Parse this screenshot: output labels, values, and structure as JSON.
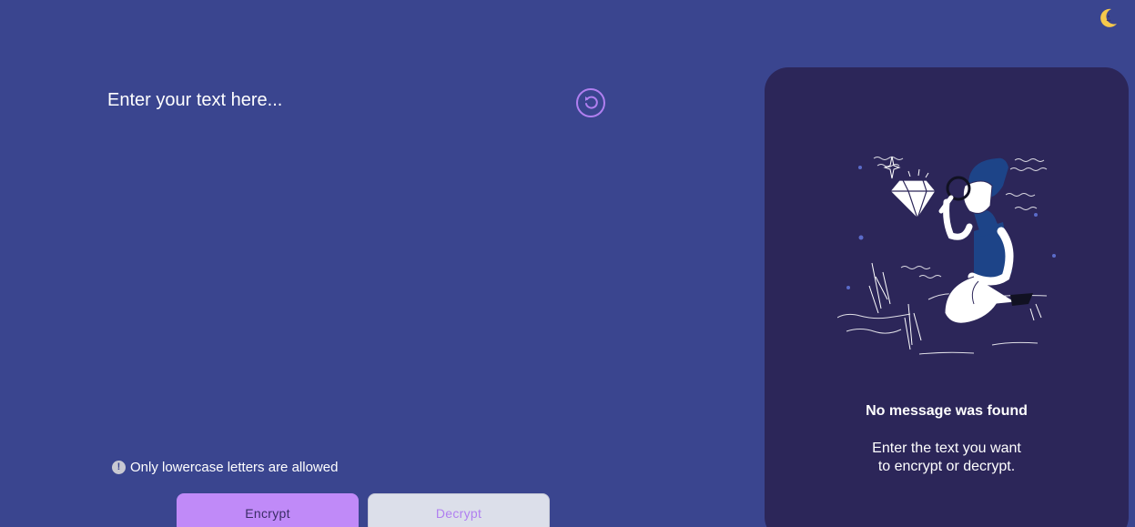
{
  "theme_toggle": {
    "icon": "moon-icon",
    "color": "#f5c84b"
  },
  "input": {
    "placeholder": "Enter your text here...",
    "value": ""
  },
  "reset": {
    "icon": "undo-icon",
    "color": "#b07ff0"
  },
  "warning": {
    "icon": "exclamation-circle-icon",
    "text": "Only lowercase letters are allowed"
  },
  "buttons": {
    "encrypt": "Encrypt",
    "decrypt": "Decrypt"
  },
  "output": {
    "illustration": "person-examining-diamond-illustration",
    "title": "No message was found",
    "line1": "Enter the text you want",
    "line2": "to encrypt or decrypt."
  },
  "colors": {
    "background": "#3a458f",
    "panel": "#2c2659",
    "accent": "#c08af8",
    "decrypt_bg": "#dcdfea"
  }
}
